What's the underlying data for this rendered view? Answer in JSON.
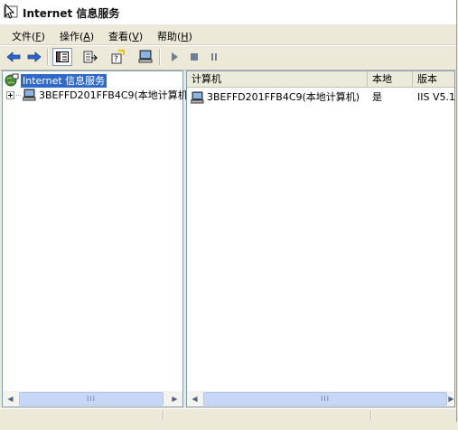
{
  "window": {
    "title": "Internet 信息服务"
  },
  "menu": [
    {
      "label": "文件(",
      "key": "F",
      "end": ")"
    },
    {
      "label": "操作(",
      "key": "A",
      "end": ")"
    },
    {
      "label": "查看(",
      "key": "V",
      "end": ")"
    },
    {
      "label": "帮助(",
      "key": "H",
      "end": ")"
    }
  ],
  "toolbar": {
    "icons": [
      "back-arrow-icon",
      "forward-arrow-icon",
      "show-hide-tree-icon",
      "export-list-icon",
      "help-icon",
      "connect-computer-icon",
      "start-icon",
      "stop-icon",
      "pause-icon"
    ]
  },
  "tree": {
    "root_label": "Internet 信息服务",
    "child_label": "3BEFFD201FFB4C9(本地计算机"
  },
  "list": {
    "columns": [
      "计算机",
      "本地",
      "版本"
    ],
    "rows": [
      {
        "computer": "3BEFFD201FFB4C9(本地计算机)",
        "local": "是",
        "version": "IIS V5.1"
      }
    ]
  },
  "scrollbar": {
    "grip": "III"
  },
  "colors": {
    "selection": "#316ac5",
    "pane_border": "#7f9db9",
    "chrome": "#ece9d8"
  }
}
